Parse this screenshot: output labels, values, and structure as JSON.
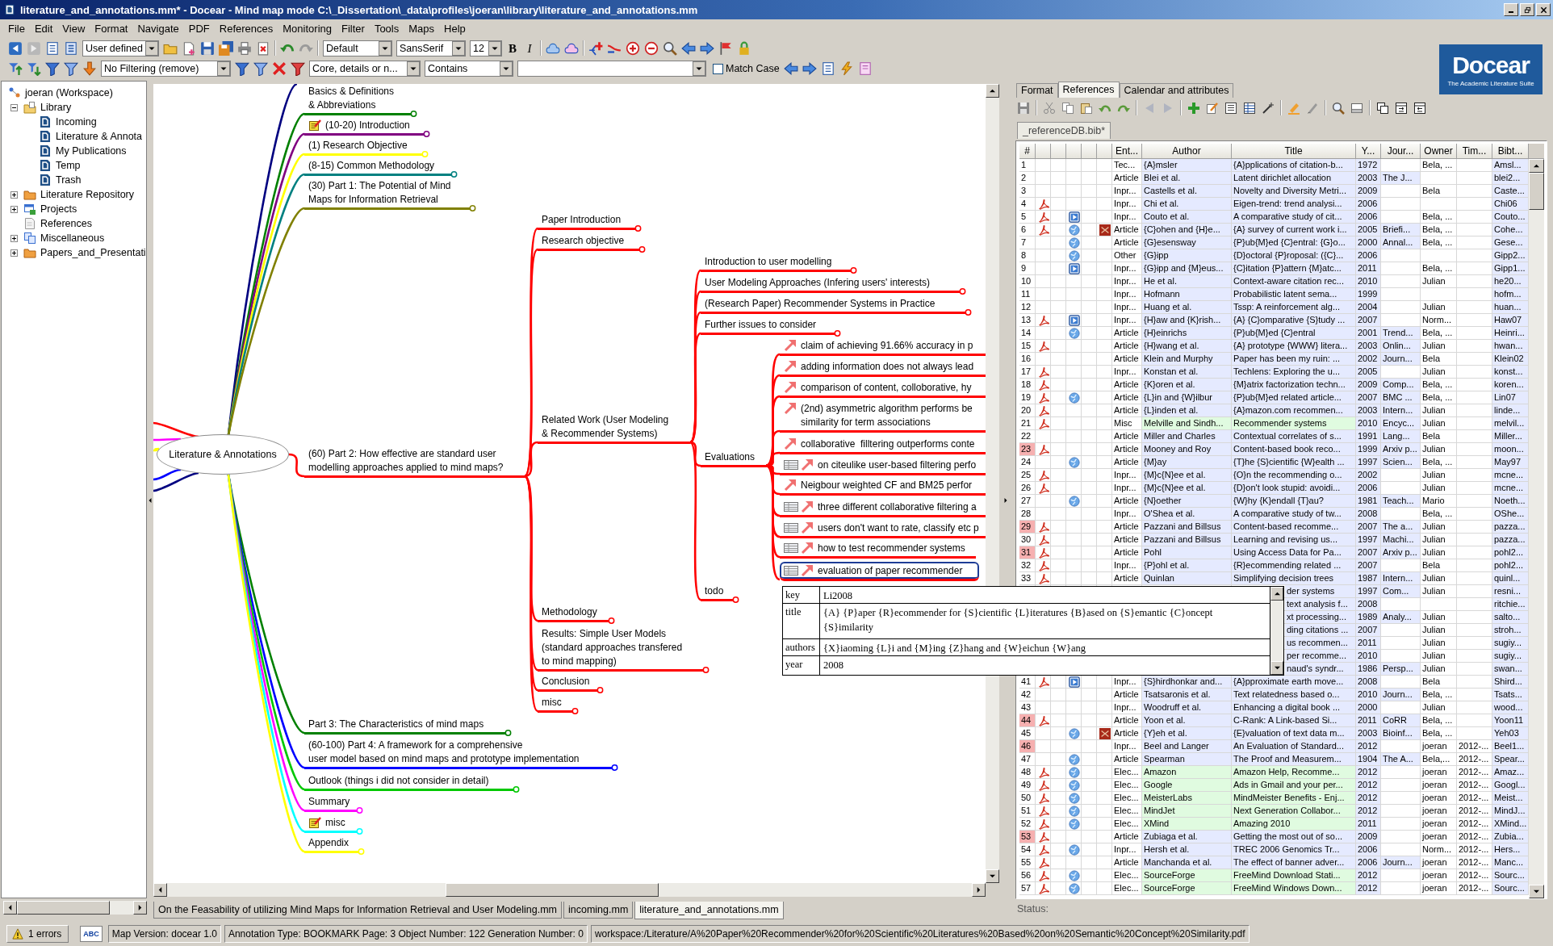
{
  "window": {
    "title": "literature_and_annotations.mm* - Docear - Mind map mode C:\\_Dissertation\\_data\\profiles\\joeran\\library\\literature_and_annotations.mm"
  },
  "menu": [
    "File",
    "Edit",
    "View",
    "Format",
    "Navigate",
    "PDF",
    "References",
    "Monitoring",
    "Filter",
    "Tools",
    "Maps",
    "Help"
  ],
  "toolbar": {
    "view_mode": "User defined",
    "node_style": "Default",
    "font_family": "SansSerif",
    "font_size": "12",
    "bold": "B",
    "italic": "I"
  },
  "filter_toolbar": {
    "filter": "No Filtering (remove)",
    "search_scope": "Core, details or n...",
    "search_mode": "Contains",
    "match_case": {
      "label": "Match Case",
      "checked": false
    }
  },
  "logo": {
    "name": "Docear",
    "tagline": "The Academic Literature Suite"
  },
  "workspace_tree": {
    "items": [
      {
        "label": "joeran (Workspace)",
        "kind": "workspace",
        "selected": false,
        "children": [
          {
            "label": "Library",
            "kind": "library",
            "expanded": true,
            "selected": false,
            "children": [
              {
                "label": "Incoming",
                "kind": "map",
                "selected": false
              },
              {
                "label": "Literature & Annota",
                "kind": "map",
                "selected": false
              },
              {
                "label": "My Publications",
                "kind": "map",
                "selected": false
              },
              {
                "label": "Temp",
                "kind": "map",
                "selected": false
              },
              {
                "label": "Trash",
                "kind": "map",
                "selected": false
              }
            ]
          },
          {
            "label": "Literature Repository",
            "kind": "folder",
            "expanded": false,
            "selected": false
          },
          {
            "label": "Projects",
            "kind": "project",
            "expanded": false,
            "selected": false
          },
          {
            "label": "References",
            "kind": "bibtex",
            "selected": false
          },
          {
            "label": "Miscellaneous",
            "kind": "misc",
            "expanded": false,
            "selected": false
          },
          {
            "label": "Papers_and_Presentati",
            "kind": "folder",
            "expanded": false,
            "selected": false
          }
        ]
      }
    ]
  },
  "mind_map": {
    "root": {
      "text": "Literature & Annotations",
      "selected": false,
      "cut_branches": [
        {
          "kind": "top",
          "color": "#000080"
        },
        {
          "kind": "left",
          "color": "#ff0000"
        },
        {
          "kind": "left",
          "color": "#ff00ff"
        },
        {
          "kind": "left",
          "color": "#ffff00"
        },
        {
          "kind": "left",
          "color": "#0000ff"
        },
        {
          "kind": "left",
          "color": "#000080"
        }
      ],
      "children": [
        {
          "text": "Basics & Definitions\n& Abbreviations",
          "color": "#008000",
          "note": false,
          "folded": true,
          "selected": false
        },
        {
          "text": "(10-20) Introduction",
          "color": "#800080",
          "note": true,
          "folded": true,
          "selected": false
        },
        {
          "text": "(1) Research Objective",
          "color": "#ffff00",
          "note": false,
          "folded": true,
          "selected": false
        },
        {
          "text": "(8-15) Common Methodology",
          "color": "#008080",
          "note": false,
          "folded": true,
          "selected": false
        },
        {
          "text": "(30) Part 1: The Potential of Mind\nMaps for Information Retrieval",
          "color": "#808000",
          "note": false,
          "folded": true,
          "selected": false
        },
        {
          "text": "(60) Part 2: How effective are standard user\nmodelling approaches applied to mind maps?",
          "color": "#ff0000",
          "note": false,
          "folded": false,
          "selected": false,
          "children": [
            {
              "text": "Paper Introduction",
              "folded": true,
              "selected": false
            },
            {
              "text": "Research objective",
              "folded": true,
              "selected": false
            },
            {
              "text": "Related Work (User Modeling\n& Recommender Systems)",
              "folded": false,
              "selected": false,
              "children": [
                {
                  "text": "Introduction to user modelling",
                  "folded": true,
                  "selected": false
                },
                {
                  "text": "User Modeling Approaches (Infering users' interests)",
                  "folded": true,
                  "selected": false
                },
                {
                  "text": "(Research Paper) Recommender Systems in Practice",
                  "folded": true,
                  "selected": false
                },
                {
                  "text": "Further issues to consider",
                  "folded": true,
                  "selected": false
                },
                {
                  "text": "Evaluations",
                  "folded": false,
                  "selected": false,
                  "children": [
                    {
                      "text": "claim of achieving 91.66% accuracy in p",
                      "annotation": false,
                      "link": true,
                      "selected": false
                    },
                    {
                      "text": "adding information does not always lead",
                      "annotation": false,
                      "link": true,
                      "selected": false
                    },
                    {
                      "text": "comparison of content, colloborative, hy",
                      "annotation": false,
                      "link": true,
                      "selected": false
                    },
                    {
                      "text": "(2nd) asymmetric algorithm performs be\nsimilarity for term associations",
                      "annotation": false,
                      "link": true,
                      "selected": false
                    },
                    {
                      "text": "collaborative  filltering outperforms conte",
                      "annotation": false,
                      "link": true,
                      "selected": false
                    },
                    {
                      "text": "on citeulike user-based filtering perfo",
                      "annotation": true,
                      "link": true,
                      "selected": false
                    },
                    {
                      "text": "Neigbour weighted CF and BM25 perfor",
                      "annotation": false,
                      "link": true,
                      "selected": false
                    },
                    {
                      "text": "three different collaborative filtering a",
                      "annotation": true,
                      "link": true,
                      "selected": false
                    },
                    {
                      "text": "users don't want to rate, classify etc p",
                      "annotation": true,
                      "link": true,
                      "selected": false
                    },
                    {
                      "text": "how to test recommender systems",
                      "annotation": true,
                      "link": true,
                      "selected": false
                    },
                    {
                      "text": "evaluation of paper recommender",
                      "annotation": true,
                      "link": true,
                      "selected": true
                    }
                  ]
                },
                {
                  "text": "todo",
                  "folded": true,
                  "selected": false
                }
              ]
            },
            {
              "text": "Methodology",
              "folded": true,
              "selected": false
            },
            {
              "text": "Results: Simple User Models\n(standard approaches transfered\nto mind mapping)",
              "folded": true,
              "selected": false
            },
            {
              "text": "Conclusion",
              "folded": true,
              "selected": false
            },
            {
              "text": "misc",
              "folded": true,
              "selected": false
            }
          ]
        },
        {
          "text": "Part 3: The Characteristics of mind maps",
          "color": "#008000",
          "note": false,
          "folded": true,
          "selected": false
        },
        {
          "text": "(60-100) Part 4: A framework for a comprehensive\nuser model based on mind maps and prototype implementation",
          "color": "#0000ff",
          "note": false,
          "folded": true,
          "selected": false
        },
        {
          "text": "Outlook (things i did not consider in detail)",
          "color": "#00c800",
          "note": false,
          "folded": true,
          "selected": false
        },
        {
          "text": "Summary",
          "color": "#ff00ff",
          "note": false,
          "folded": true,
          "selected": false
        },
        {
          "text": "misc",
          "color": "#00ffff",
          "note": true,
          "folded": true,
          "selected": false
        },
        {
          "text": "Appendix",
          "color": "#ffff00",
          "note": false,
          "folded": true,
          "selected": false
        }
      ]
    },
    "tabs": [
      {
        "label": "On the Feasability of utilizing Mind Maps for Information Retrieval and User Modeling.mm",
        "selected": false
      },
      {
        "label": "incoming.mm",
        "selected": false
      },
      {
        "label": "literature_and_annotations.mm",
        "selected": true
      }
    ]
  },
  "reference_panel": {
    "tabs": [
      {
        "label": "Format",
        "selected": false
      },
      {
        "label": "References",
        "selected": true
      },
      {
        "label": "Calendar and attributes",
        "selected": false
      }
    ],
    "database_tab": {
      "label": "_referenceDB.bib*",
      "selected": true
    },
    "table": {
      "columns": [
        "#",
        "Ent...",
        "Author",
        "Title",
        "Y...",
        "Jour...",
        "Owner",
        "Tim...",
        "Bibt..."
      ],
      "rows": [
        {
          "kind": "entry",
          "number": "1",
          "marked": false,
          "selected": false,
          "pdf": false,
          "arxiv": false,
          "optional": false,
          "entry": "Tec...",
          "author": "{A}msler",
          "title": "{A}pplications of citation-b...",
          "year": "1972",
          "owner": "Bela, ...",
          "bibtexkey": "Amsl..."
        },
        {
          "kind": "entry",
          "number": "2",
          "marked": false,
          "selected": false,
          "pdf": false,
          "arxiv": false,
          "optional": false,
          "entry": "Article",
          "author": "Blei et al.",
          "title": "Latent dirichlet allocation",
          "year": "2003",
          "journal": "The J...",
          "bibtexkey": "blei2..."
        },
        {
          "kind": "entry",
          "number": "3",
          "marked": false,
          "selected": false,
          "pdf": false,
          "arxiv": false,
          "optional": false,
          "entry": "Inpr...",
          "author": "Castells et al.",
          "title": "Novelty and Diversity Metri...",
          "year": "2009",
          "owner": "Bela",
          "bibtexkey": "Caste..."
        },
        {
          "kind": "entry",
          "number": "4",
          "marked": false,
          "selected": false,
          "pdf": true,
          "arxiv": false,
          "optional": false,
          "entry": "Inpr...",
          "author": "Chi et al.",
          "title": "Eigen-trend: trend analysi...",
          "year": "2006",
          "bibtexkey": "Chi06"
        },
        {
          "kind": "entry",
          "number": "5",
          "marked": false,
          "selected": false,
          "pdf": true,
          "link": {
            "kind": "video"
          },
          "arxiv": false,
          "optional": false,
          "entry": "Inpr...",
          "author": "Couto et al.",
          "title": "A comparative study of cit...",
          "year": "2006",
          "owner": "Bela, ...",
          "bibtexkey": "Couto..."
        },
        {
          "kind": "entry",
          "number": "6",
          "marked": false,
          "selected": false,
          "pdf": true,
          "link": {
            "kind": "web"
          },
          "arxiv": true,
          "optional": false,
          "entry": "Article",
          "author": "{C}ohen and {H}e...",
          "title": "{A} survey of current work i...",
          "year": "2005",
          "journal": "Briefi...",
          "owner": "Bela, ...",
          "bibtexkey": "Cohe..."
        },
        {
          "kind": "entry",
          "number": "7",
          "marked": false,
          "selected": false,
          "pdf": false,
          "link": {
            "kind": "web"
          },
          "arxiv": false,
          "optional": false,
          "entry": "Article",
          "author": "{G}esensway",
          "title": "{P}ub{M}ed {C}entral: {G}o...",
          "year": "2000",
          "journal": "Annal...",
          "owner": "Bela, ...",
          "bibtexkey": "Gese..."
        },
        {
          "kind": "entry",
          "number": "8",
          "marked": false,
          "selected": false,
          "pdf": false,
          "link": {
            "kind": "web"
          },
          "arxiv": false,
          "optional": false,
          "entry": "Other",
          "author": "{G}ipp",
          "title": "{D}octoral {P}roposal: ({C}...",
          "year": "2006",
          "bibtexkey": "Gipp2..."
        },
        {
          "kind": "entry",
          "number": "9",
          "marked": false,
          "selected": false,
          "pdf": false,
          "link": {
            "kind": "video"
          },
          "arxiv": false,
          "optional": false,
          "entry": "Inpr...",
          "author": "{G}ipp and {M}eus...",
          "title": "{C}itation {P}attern {M}atc...",
          "year": "2011",
          "owner": "Bela, ...",
          "bibtexkey": "Gipp1..."
        },
        {
          "kind": "entry",
          "number": "10",
          "marked": false,
          "selected": false,
          "pdf": false,
          "arxiv": false,
          "optional": false,
          "entry": "Inpr...",
          "author": "He et al.",
          "title": "Context-aware citation rec...",
          "year": "2010",
          "owner": "Julian",
          "bibtexkey": "he20..."
        },
        {
          "kind": "entry",
          "number": "11",
          "marked": false,
          "selected": false,
          "pdf": false,
          "arxiv": false,
          "optional": false,
          "entry": "Inpr...",
          "author": "Hofmann",
          "title": "Probabilistic latent sema...",
          "year": "1999",
          "bibtexkey": "hofm..."
        },
        {
          "kind": "entry",
          "number": "12",
          "marked": false,
          "selected": false,
          "pdf": false,
          "arxiv": false,
          "optional": false,
          "entry": "Inpr...",
          "author": "Huang et al.",
          "title": "Tssp: A reinforcement alg...",
          "year": "2004",
          "owner": "Julian",
          "bibtexkey": "huan..."
        },
        {
          "kind": "entry",
          "number": "13",
          "marked": false,
          "selected": false,
          "pdf": true,
          "link": {
            "kind": "video"
          },
          "arxiv": false,
          "optional": false,
          "entry": "Inpr...",
          "author": "{H}aw and {K}rish...",
          "title": "{A} {C}omparative {S}tudy ...",
          "year": "2007",
          "owner": "Norm...",
          "bibtexkey": "Haw07"
        },
        {
          "kind": "entry",
          "number": "14",
          "marked": false,
          "selected": false,
          "pdf": false,
          "link": {
            "kind": "web"
          },
          "arxiv": false,
          "optional": false,
          "entry": "Article",
          "author": "{H}einrichs",
          "title": "{P}ub{M}ed {C}entral",
          "year": "2001",
          "journal": "Trend...",
          "owner": "Bela, ...",
          "bibtexkey": "Heinri..."
        },
        {
          "kind": "entry",
          "number": "15",
          "marked": false,
          "selected": false,
          "pdf": true,
          "arxiv": false,
          "optional": false,
          "entry": "Article",
          "author": "{H}wang et al.",
          "title": "{A} prototype {WWW} litera...",
          "year": "2003",
          "journal": "Onlin...",
          "owner": "Julian",
          "bibtexkey": "hwan..."
        },
        {
          "kind": "entry",
          "number": "16",
          "marked": false,
          "selected": false,
          "pdf": false,
          "arxiv": false,
          "optional": false,
          "entry": "Article",
          "author": "Klein and Murphy",
          "title": "Paper has been my ruin: ...",
          "year": "2002",
          "journal": "Journ...",
          "owner": "Bela",
          "bibtexkey": "Klein02"
        },
        {
          "kind": "entry",
          "number": "17",
          "marked": false,
          "selected": false,
          "pdf": true,
          "arxiv": false,
          "optional": false,
          "entry": "Inpr...",
          "author": "Konstan et al.",
          "title": "Techlens: Exploring the u...",
          "year": "2005",
          "owner": "Julian",
          "bibtexkey": "konst..."
        },
        {
          "kind": "entry",
          "number": "18",
          "marked": false,
          "selected": false,
          "pdf": true,
          "arxiv": false,
          "optional": false,
          "entry": "Article",
          "author": "{K}oren et al.",
          "title": "{M}atrix factorization techn...",
          "year": "2009",
          "journal": "Comp...",
          "owner": "Bela, ...",
          "bibtexkey": "koren..."
        },
        {
          "kind": "entry",
          "number": "19",
          "marked": false,
          "selected": false,
          "pdf": true,
          "link": {
            "kind": "web"
          },
          "arxiv": false,
          "optional": false,
          "entry": "Article",
          "author": "{L}in and {W}ilbur",
          "title": "{P}ub{M}ed related article...",
          "year": "2007",
          "journal": "BMC ...",
          "owner": "Bela, ...",
          "bibtexkey": "Lin07"
        },
        {
          "kind": "entry",
          "number": "20",
          "marked": false,
          "selected": false,
          "pdf": true,
          "arxiv": false,
          "optional": false,
          "entry": "Article",
          "author": "{L}inden et al.",
          "title": "{A}mazon.com recommen...",
          "year": "2003",
          "journal": "Intern...",
          "owner": "Julian",
          "bibtexkey": "linde..."
        },
        {
          "kind": "entry",
          "number": "21",
          "marked": false,
          "selected": false,
          "pdf": true,
          "arxiv": false,
          "optional": true,
          "entry": "Misc",
          "author": "Melville and Sindh...",
          "title": "Recommender systems",
          "year": "2010",
          "journal": "Encyc...",
          "owner": "Julian",
          "bibtexkey": "melvil..."
        },
        {
          "kind": "entry",
          "number": "22",
          "marked": false,
          "selected": false,
          "pdf": false,
          "arxiv": false,
          "optional": false,
          "entry": "Article",
          "author": "Miller and Charles",
          "title": "Contextual correlates of s...",
          "year": "1991",
          "journal": "Lang...",
          "owner": "Bela",
          "bibtexkey": "Miller..."
        },
        {
          "kind": "entry",
          "number": "23",
          "marked": true,
          "selected": false,
          "pdf": true,
          "arxiv": false,
          "optional": false,
          "entry": "Article",
          "author": "Mooney and Roy",
          "title": "Content-based book reco...",
          "year": "1999",
          "journal": "Arxiv p...",
          "owner": "Julian",
          "bibtexkey": "moon..."
        },
        {
          "kind": "entry",
          "number": "24",
          "marked": false,
          "selected": false,
          "pdf": false,
          "link": {
            "kind": "web"
          },
          "arxiv": false,
          "optional": false,
          "entry": "Article",
          "author": "{M}ay",
          "title": "{T}he {S}cientific {W}ealth ...",
          "year": "1997",
          "journal": "Scien...",
          "owner": "Bela, ...",
          "bibtexkey": "May97"
        },
        {
          "kind": "entry",
          "number": "25",
          "marked": false,
          "selected": false,
          "pdf": true,
          "arxiv": false,
          "optional": false,
          "entry": "Inpr...",
          "author": "{M}c{N}ee et al.",
          "title": "{O}n the recommending o...",
          "year": "2002",
          "owner": "Julian",
          "bibtexkey": "mcne..."
        },
        {
          "kind": "entry",
          "number": "26",
          "marked": false,
          "selected": false,
          "pdf": true,
          "arxiv": false,
          "optional": false,
          "entry": "Inpr...",
          "author": "{M}c{N}ee et al.",
          "title": "{D}on't look stupid: avoidi...",
          "year": "2006",
          "owner": "Julian",
          "bibtexkey": "mcne..."
        },
        {
          "kind": "entry",
          "number": "27",
          "marked": false,
          "selected": false,
          "pdf": false,
          "link": {
            "kind": "web"
          },
          "arxiv": false,
          "optional": false,
          "entry": "Article",
          "author": "{N}oether",
          "title": "{W}hy {K}endall {T}au?",
          "year": "1981",
          "journal": "Teach...",
          "owner": "Mario",
          "bibtexkey": "Noeth..."
        },
        {
          "kind": "entry",
          "number": "28",
          "marked": false,
          "selected": false,
          "pdf": false,
          "arxiv": false,
          "optional": false,
          "entry": "Inpr...",
          "author": "O'Shea et al.",
          "title": "A comparative study of tw...",
          "year": "2008",
          "owner": "Bela, ...",
          "bibtexkey": "OShe..."
        },
        {
          "kind": "entry",
          "number": "29",
          "marked": true,
          "selected": false,
          "pdf": true,
          "arxiv": false,
          "optional": false,
          "entry": "Article",
          "author": "Pazzani and Billsus",
          "title": "Content-based recomme...",
          "year": "2007",
          "journal": "The a...",
          "owner": "Julian",
          "bibtexkey": "pazza..."
        },
        {
          "kind": "entry",
          "number": "30",
          "marked": false,
          "selected": false,
          "pdf": true,
          "arxiv": false,
          "optional": false,
          "entry": "Article",
          "author": "Pazzani and Billsus",
          "title": "Learning and revising us...",
          "year": "1997",
          "journal": "Machi...",
          "owner": "Julian",
          "bibtexkey": "pazza..."
        },
        {
          "kind": "entry",
          "number": "31",
          "marked": true,
          "selected": false,
          "pdf": true,
          "arxiv": false,
          "optional": false,
          "entry": "Article",
          "author": "Pohl",
          "title": "Using Access Data for Pa...",
          "year": "2007",
          "journal": "Arxiv p...",
          "owner": "Julian",
          "bibtexkey": "pohl2..."
        },
        {
          "kind": "entry",
          "number": "32",
          "marked": false,
          "selected": false,
          "pdf": true,
          "arxiv": false,
          "optional": false,
          "entry": "Inpr...",
          "author": "{P}ohl et al.",
          "title": "{R}ecommending related ...",
          "year": "2007",
          "owner": "Bela",
          "bibtexkey": "pohl2..."
        },
        {
          "kind": "entry",
          "number": "33",
          "marked": false,
          "selected": false,
          "pdf": true,
          "arxiv": false,
          "optional": false,
          "entry": "Article",
          "author": "Quinlan",
          "title": "Simplifying decision trees",
          "year": "1987",
          "journal": "Intern...",
          "owner": "Julian",
          "bibtexkey": "quinl..."
        },
        {
          "kind": "covered",
          "selected": false,
          "optional": false,
          "title": "der systems",
          "year": "1997",
          "journal": "Com...",
          "owner": "Julian",
          "bibtexkey": "resni..."
        },
        {
          "kind": "covered",
          "selected": false,
          "optional": false,
          "title": "text analysis f...",
          "year": "2008",
          "bibtexkey": "ritchie..."
        },
        {
          "kind": "covered",
          "selected": false,
          "optional": false,
          "title": "xt processing...",
          "year": "1989",
          "journal": "Analy...",
          "owner": "Julian",
          "bibtexkey": "salto..."
        },
        {
          "kind": "covered",
          "selected": false,
          "optional": false,
          "title": "ding citations ...",
          "year": "2007",
          "owner": "Julian",
          "bibtexkey": "stroh..."
        },
        {
          "kind": "covered",
          "selected": false,
          "optional": false,
          "title": "us recommen...",
          "year": "2011",
          "owner": "Julian",
          "bibtexkey": "sugiy..."
        },
        {
          "kind": "covered",
          "selected": false,
          "optional": false,
          "title": "per recomme...",
          "year": "2010",
          "owner": "Julian",
          "bibtexkey": "sugiy..."
        },
        {
          "kind": "covered",
          "selected": false,
          "optional": false,
          "title": "naud's syndr...",
          "year": "1986",
          "journal": "Persp...",
          "owner": "Julian",
          "bibtexkey": "swan..."
        },
        {
          "kind": "entry",
          "number": "41",
          "marked": false,
          "selected": false,
          "pdf": true,
          "link": {
            "kind": "video"
          },
          "arxiv": false,
          "optional": false,
          "entry": "Inpr...",
          "author": "{S}hirdhonkar and...",
          "title": "{A}pproximate earth move...",
          "year": "2008",
          "owner": "Bela",
          "bibtexkey": "Shird..."
        },
        {
          "kind": "entry",
          "number": "42",
          "marked": false,
          "selected": false,
          "pdf": false,
          "arxiv": false,
          "optional": false,
          "entry": "Article",
          "author": "Tsatsaronis et al.",
          "title": "Text relatedness based o...",
          "year": "2010",
          "journal": "Journ...",
          "owner": "Bela, ...",
          "bibtexkey": "Tsats..."
        },
        {
          "kind": "entry",
          "number": "43",
          "marked": false,
          "selected": false,
          "pdf": false,
          "arxiv": false,
          "optional": false,
          "entry": "Inpr...",
          "author": "Woodruff et al.",
          "title": "Enhancing a digital book ...",
          "year": "2000",
          "owner": "Julian",
          "bibtexkey": "wood..."
        },
        {
          "kind": "entry",
          "number": "44",
          "marked": true,
          "selected": false,
          "pdf": true,
          "arxiv": false,
          "optional": false,
          "entry": "Article",
          "author": "Yoon et al.",
          "title": "C-Rank: A Link-based Si...",
          "year": "2011",
          "journal": "CoRR",
          "owner": "Bela, ...",
          "bibtexkey": "Yoon11"
        },
        {
          "kind": "entry",
          "number": "45",
          "marked": false,
          "selected": false,
          "pdf": false,
          "link": {
            "kind": "web"
          },
          "arxiv": true,
          "optional": false,
          "entry": "Article",
          "author": "{Y}eh et al.",
          "title": "{E}valuation of text data m...",
          "year": "2003",
          "journal": "Bioinf...",
          "owner": "Bela, ...",
          "bibtexkey": "Yeh03"
        },
        {
          "kind": "entry",
          "number": "46",
          "marked": true,
          "selected": false,
          "pdf": false,
          "arxiv": false,
          "optional": false,
          "entry": "Inpr...",
          "author": "Beel and Langer",
          "title": "An Evaluation of Standard...",
          "year": "2012",
          "owner": "joeran",
          "timestamp": "2012-...",
          "bibtexkey": "Beel1..."
        },
        {
          "kind": "entry",
          "number": "47",
          "marked": false,
          "selected": false,
          "pdf": false,
          "link": {
            "kind": "web"
          },
          "arxiv": false,
          "optional": false,
          "entry": "Article",
          "author": "Spearman",
          "title": "The Proof and Measurem...",
          "year": "1904",
          "journal": "The A...",
          "owner": "Bela,...",
          "timestamp": "2012-...",
          "bibtexkey": "Spear..."
        },
        {
          "kind": "entry",
          "number": "48",
          "marked": false,
          "selected": false,
          "pdf": true,
          "link": {
            "kind": "web"
          },
          "arxiv": false,
          "optional": true,
          "entry": "Elec...",
          "author": "Amazon",
          "title": "Amazon Help, Recomme...",
          "year": "2012",
          "owner": "joeran",
          "timestamp": "2012-...",
          "bibtexkey": "Amaz..."
        },
        {
          "kind": "entry",
          "number": "49",
          "marked": false,
          "selected": false,
          "pdf": true,
          "link": {
            "kind": "web"
          },
          "arxiv": false,
          "optional": true,
          "entry": "Elec...",
          "author": "Google",
          "title": "Ads in Gmail and your per...",
          "year": "2012",
          "owner": "joeran",
          "timestamp": "2012-...",
          "bibtexkey": "Googl..."
        },
        {
          "kind": "entry",
          "number": "50",
          "marked": false,
          "selected": false,
          "pdf": true,
          "link": {
            "kind": "web"
          },
          "arxiv": false,
          "optional": true,
          "entry": "Elec...",
          "author": "MeisterLabs",
          "title": "MindMeister Benefits - Enj...",
          "year": "2012",
          "owner": "joeran",
          "timestamp": "2012-...",
          "bibtexkey": "Meist..."
        },
        {
          "kind": "entry",
          "number": "51",
          "marked": false,
          "selected": false,
          "pdf": true,
          "link": {
            "kind": "web"
          },
          "arxiv": false,
          "optional": true,
          "entry": "Elec...",
          "author": "MindJet",
          "title": "Next Generation Collabor...",
          "year": "2012",
          "owner": "joeran",
          "timestamp": "2012-...",
          "bibtexkey": "MindJ..."
        },
        {
          "kind": "entry",
          "number": "52",
          "marked": false,
          "selected": false,
          "pdf": true,
          "link": {
            "kind": "web"
          },
          "arxiv": false,
          "optional": true,
          "entry": "Elec...",
          "author": "XMind",
          "title": "Amazing 2010",
          "year": "2011",
          "owner": "joeran",
          "timestamp": "2012-...",
          "bibtexkey": "XMind..."
        },
        {
          "kind": "entry",
          "number": "53",
          "marked": true,
          "selected": false,
          "pdf": true,
          "arxiv": false,
          "optional": false,
          "entry": "Article",
          "author": "Zubiaga et al.",
          "title": "Getting the most out of so...",
          "year": "2009",
          "owner": "joeran",
          "timestamp": "2012-...",
          "bibtexkey": "Zubia..."
        },
        {
          "kind": "entry",
          "number": "54",
          "marked": false,
          "selected": false,
          "pdf": true,
          "link": {
            "kind": "web"
          },
          "arxiv": false,
          "optional": false,
          "entry": "Inpr...",
          "author": "Hersh et al.",
          "title": "TREC 2006 Genomics Tr...",
          "year": "2006",
          "owner": "Norm...",
          "timestamp": "2012-...",
          "bibtexkey": "Hers..."
        },
        {
          "kind": "entry",
          "number": "55",
          "marked": false,
          "selected": false,
          "pdf": true,
          "arxiv": false,
          "optional": false,
          "entry": "Article",
          "author": "Manchanda et al.",
          "title": "The effect of banner adver...",
          "year": "2006",
          "journal": "Journ...",
          "owner": "joeran",
          "timestamp": "2012-...",
          "bibtexkey": "Manc..."
        },
        {
          "kind": "entry",
          "number": "56",
          "marked": false,
          "selected": false,
          "pdf": true,
          "link": {
            "kind": "web"
          },
          "arxiv": false,
          "optional": true,
          "entry": "Elec...",
          "author": "SourceForge",
          "title": "FreeMind Download Stati...",
          "year": "2012",
          "owner": "joeran",
          "timestamp": "2012-...",
          "bibtexkey": "Sourc..."
        },
        {
          "kind": "entry",
          "number": "57",
          "marked": false,
          "selected": false,
          "pdf": true,
          "link": {
            "kind": "web"
          },
          "arxiv": false,
          "optional": true,
          "entry": "Elec...",
          "author": "SourceForge",
          "title": "FreeMind Windows Down...",
          "year": "2012",
          "owner": "joeran",
          "timestamp": "2012-...",
          "bibtexkey": "Sourc..."
        }
      ]
    },
    "status": "Status:"
  },
  "reference_popup": {
    "fields": [
      {
        "label": "key",
        "value": "Li2008"
      },
      {
        "label": "title",
        "value": "{A} {P}aper {R}ecommender for {S}cientific {L}iteratures {B}ased on {S}emantic {C}oncept {S}imilarity"
      },
      {
        "label": "authors",
        "value": "{X}iaoming {L}i and {M}ing {Z}hang and {W}eichun {W}ang"
      },
      {
        "label": "year",
        "value": "2008"
      }
    ]
  },
  "status_bar": {
    "errors": "1 errors",
    "spellcheck": "ABC",
    "map_version": "Map Version: docear 1.0",
    "annotation": "Annotation Type: BOOKMARK Page: 3 Object Number: 122 Generation Number: 0",
    "path": "workspace:/Literature/A%20Paper%20Recommender%20for%20Scientific%20Literatures%20Based%20on%20Semantic%20Concept%20Similarity.pdf"
  }
}
